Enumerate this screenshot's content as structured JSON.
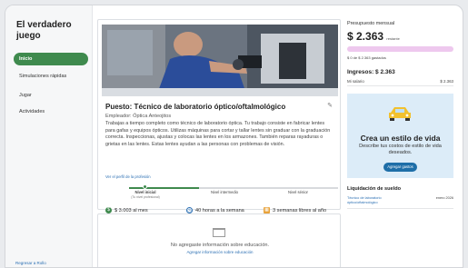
{
  "sidebar": {
    "title": "El verdadero juego",
    "items": [
      {
        "label": "Inicio",
        "active": true
      },
      {
        "label": "Simulaciones rápidas",
        "active": false
      },
      {
        "label": "Jugar",
        "active": false
      },
      {
        "label": "Actividades",
        "active": false
      }
    ],
    "footer_link": "Regresar a Rollo"
  },
  "job": {
    "title": "Puesto: Técnico de laboratorio óptico/oftalmológico",
    "employer": "Empleador: Óptica Anteojitos",
    "description": "Trabajas a tiempo completo como técnico de laboratorio óptica. Tu trabajo consiste en fabricar lentes para gafas y equipos ópticos. Utilizas máquinas para cortar y tallar lentes sin graduar con la graduación correcta. Inspeccionas, ajustas y colocas las lentes en los armazones. También reparas rayaduras o grietas en las lentes. Estas lentes ayudan a las personas con problemas de visión.",
    "profile_link": "Ver el perfil de la profesión",
    "levels": {
      "initial": "Nivel inicial",
      "initial_sub": "(Tu nivel profesional)",
      "intermediate": "Nivel intermedio",
      "senior": "Nivel sénior",
      "current_fraction": 0.07
    },
    "stats": {
      "pay": "$ 3.003 al mes",
      "hours": "40 horas a la semana",
      "vacation": "3 semanas libres al año"
    }
  },
  "education": {
    "message": "No agregaste información sobre educación.",
    "link": "Agregar información sobre educación"
  },
  "budget": {
    "label": "Presupuesto mensual",
    "amount": "$ 2.363",
    "unit": "restante",
    "spent": "$ 0 de $ 2.363 gastados",
    "spent_fraction": 0.0
  },
  "income": {
    "title": "Ingresos: $ 2.363",
    "row_label": "Mi salario",
    "row_value": "$ 2.363"
  },
  "promo": {
    "title": "Crea un estilo de vida",
    "text": "Describe tus costos de estilo de vida deseados.",
    "button": "Agregar gastos"
  },
  "loan": {
    "title": "Liquidación de sueldo",
    "row_label": "Técnico de laboratorio óptico/oftalmológico",
    "row_value": "enero 2026"
  },
  "colors": {
    "accent_green": "#3f8a4e",
    "link_blue": "#2b6fb3",
    "budget_bar": "#eec8ee",
    "promo_bg": "#dcecf8",
    "button_blue": "#1e6ea8",
    "car_yellow": "#f2c12e"
  },
  "icons": {
    "pay": "money-icon",
    "hours": "clock-icon",
    "vacation": "calendar-icon",
    "edit": "pencil-icon",
    "education": "folder-icon",
    "promo": "car-icon"
  }
}
